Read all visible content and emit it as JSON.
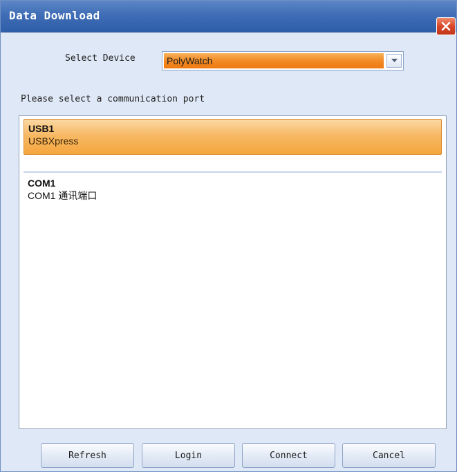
{
  "window": {
    "title": "Data Download",
    "close_icon": "close-icon"
  },
  "device": {
    "label": "Select Device",
    "selected": "PolyWatch",
    "arrow_icon": "chevron-down-icon"
  },
  "prompt": "Please select a communication port",
  "ports": [
    {
      "name": "USB1",
      "description": "USBXpress",
      "selected": true
    },
    {
      "name": "COM1",
      "description": "COM1 通讯端口",
      "selected": false
    }
  ],
  "buttons": {
    "refresh": "Refresh",
    "login": "Login",
    "connect": "Connect",
    "cancel": "Cancel"
  },
  "colors": {
    "title_bar": "#3f6db6",
    "selection": "#f5a63e",
    "close": "#d9482a"
  }
}
